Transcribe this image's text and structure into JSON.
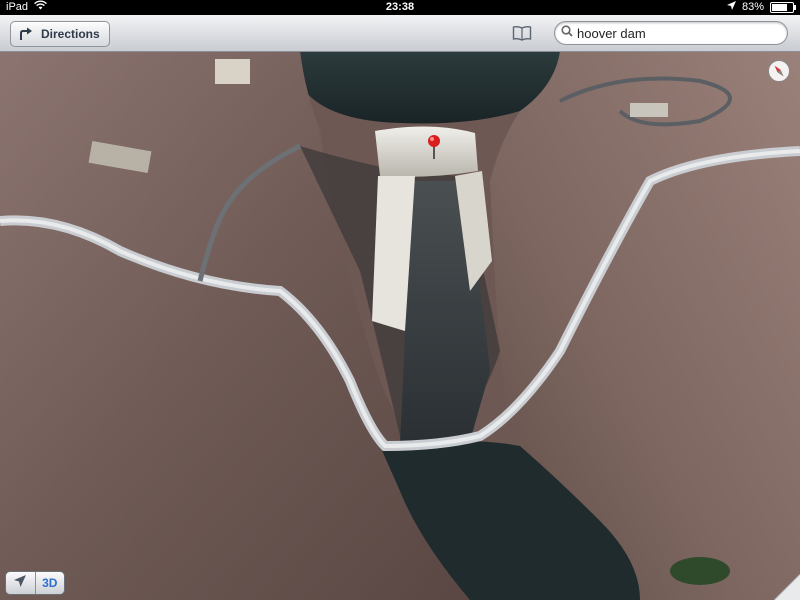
{
  "status_bar": {
    "carrier": "iPad",
    "time": "23:38",
    "battery": "83%",
    "battery_level": 0.83,
    "icons": [
      "wifi-icon",
      "location-arrow-icon",
      "battery-icon"
    ]
  },
  "toolbar": {
    "directions_label": "Directions",
    "directions_icon": "turn-arrow-icon",
    "bookmarks_icon": "bookmarks-icon",
    "search": {
      "value": "hoover dam",
      "icon": "search-icon"
    }
  },
  "map": {
    "view": "3D satellite",
    "pin_icon": "red-map-pin-icon",
    "compass_icon": "compass-icon"
  },
  "controls": {
    "locate_icon": "location-arrow-icon",
    "mode_3d_label": "3D",
    "page_curl_icon": "page-curl-icon"
  },
  "colors": {
    "accent": "#2c6fcf",
    "toolbar_top": "#f2f3f5",
    "toolbar_bottom": "#c9ccd2",
    "pin": "#d81e1e"
  }
}
